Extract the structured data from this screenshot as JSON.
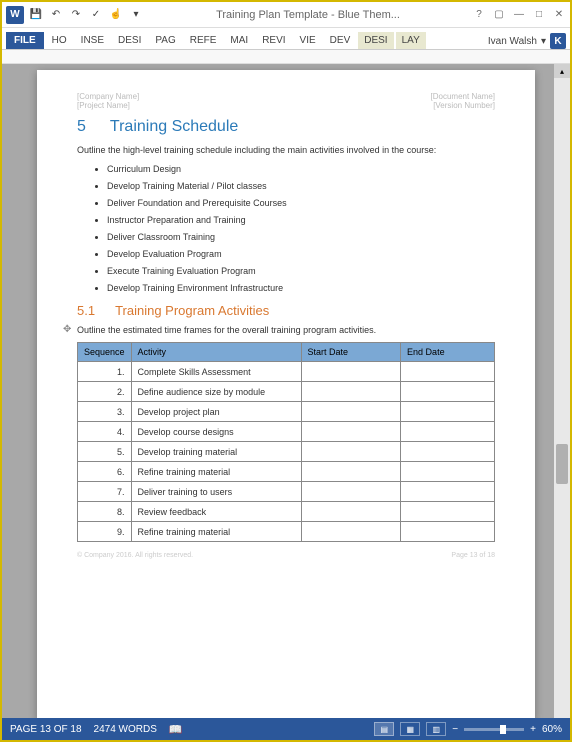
{
  "titlebar": {
    "title": "Training Plan Template - Blue Them..."
  },
  "ribbon": {
    "file": "FILE",
    "tabs": [
      "HO",
      "INSE",
      "DESI",
      "PAG",
      "REFE",
      "MAI",
      "REVI",
      "VIE",
      "DEV",
      "DESI",
      "LAY"
    ],
    "user": "Ivan Walsh",
    "user_initial": "K"
  },
  "document": {
    "header_left_1": "[Company Name]",
    "header_left_2": "[Project Name]",
    "header_right_1": "[Document Name]",
    "header_right_2": "[Version Number]",
    "section_num": "5",
    "section_title": "Training Schedule",
    "intro": "Outline the high-level training schedule including the main activities involved in the course:",
    "bullets": [
      "Curriculum Design",
      "Develop Training Material / Pilot classes",
      "Deliver Foundation and Prerequisite Courses",
      "Instructor Preparation and Training",
      "Deliver Classroom Training",
      "Develop Evaluation Program",
      "Execute Training Evaluation Program",
      "Develop Training Environment Infrastructure"
    ],
    "sub_num": "5.1",
    "sub_title": "Training Program Activities",
    "sub_intro": "Outline the estimated time frames for the overall training program activities.",
    "table": {
      "headers": [
        "Sequence",
        "Activity",
        "Start Date",
        "End Date"
      ],
      "rows": [
        {
          "seq": "1.",
          "act": "Complete Skills Assessment"
        },
        {
          "seq": "2.",
          "act": "Define audience size by module"
        },
        {
          "seq": "3.",
          "act": "Develop project plan"
        },
        {
          "seq": "4.",
          "act": "Develop course designs"
        },
        {
          "seq": "5.",
          "act": "Develop training material"
        },
        {
          "seq": "6.",
          "act": "Refine training material"
        },
        {
          "seq": "7.",
          "act": "Deliver training to users"
        },
        {
          "seq": "8.",
          "act": "Review feedback"
        },
        {
          "seq": "9.",
          "act": "Refine training material"
        }
      ]
    },
    "footer_left": "© Company 2016. All rights reserved.",
    "footer_right": "Page 13 of 18"
  },
  "status": {
    "page": "PAGE 13 OF 18",
    "words": "2474 WORDS",
    "zoom": "60%"
  }
}
